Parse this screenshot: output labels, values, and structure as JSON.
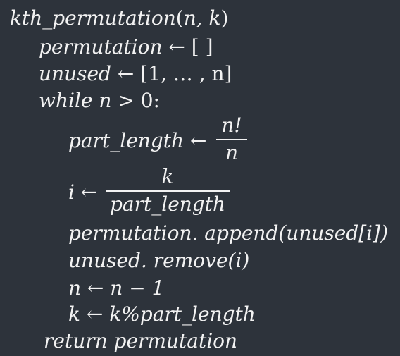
{
  "algorithm": {
    "signature": {
      "name": "kth_permutation",
      "open_paren": "(",
      "args": "n, k",
      "close_paren": ")"
    },
    "lines": [
      {
        "lhs": "permutation",
        "arrow": "←",
        "rhs": "[ ]"
      },
      {
        "lhs": "unused",
        "arrow": "←",
        "rhs": "[1, … , n]"
      },
      {
        "keyword": "while",
        "cond_var": "n",
        "cond_op": ">",
        "cond_val": "0:"
      }
    ],
    "loop_body": {
      "part_length": {
        "lhs": "part_length",
        "arrow": "←",
        "numerator": "n!",
        "denominator": "n"
      },
      "i_assign": {
        "lhs": "i",
        "arrow": "←",
        "numerator": "k",
        "denominator": "part_length"
      },
      "append_line": "permutation. append(unused[i])",
      "remove_line": "unused. remove(i)",
      "decrement_line": "n ← n − 1",
      "mod_line": "k ← k%part_length"
    },
    "return_line": "return permutation"
  }
}
